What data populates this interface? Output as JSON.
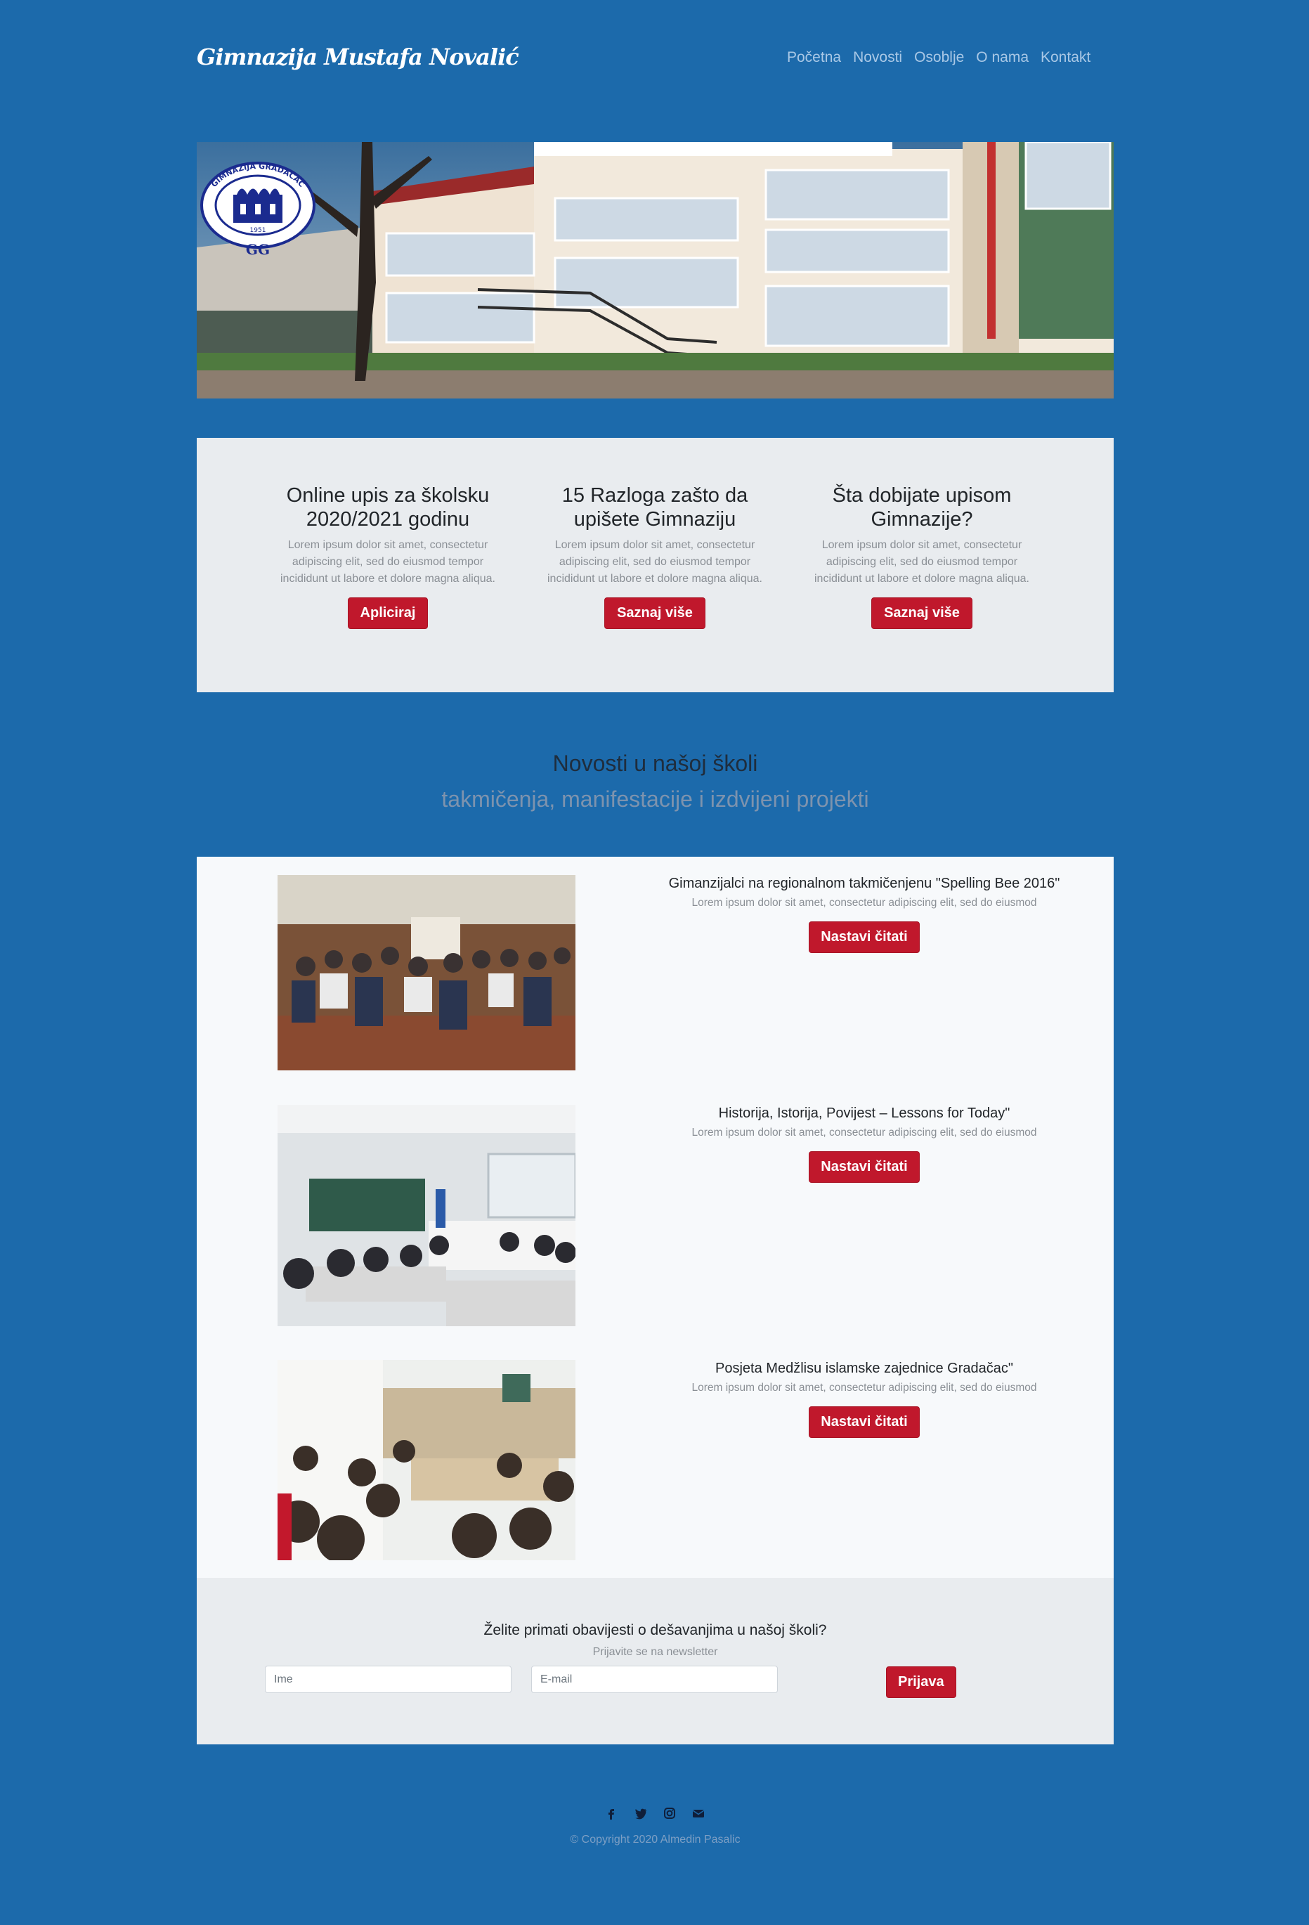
{
  "brand": "Gimnazija Mustafa Novalić",
  "nav": {
    "items": [
      "Početna",
      "Novosti",
      "Osoblje",
      "O nama",
      "Kontakt"
    ]
  },
  "hero": {
    "logo_text": "GIMNAZIJA GRADAČAC",
    "logo_year": "1951",
    "logo_initials": "GG"
  },
  "features": [
    {
      "title": "Online upis za školsku 2020/2021 godinu",
      "text": "Lorem ipsum dolor sit amet, consectetur adipiscing elit, sed do eiusmod tempor incididunt ut labore et dolore magna aliqua.",
      "button": "Apliciraj"
    },
    {
      "title": "15 Razloga zašto da upišete Gimnaziju",
      "text": "Lorem ipsum dolor sit amet, consectetur adipiscing elit, sed do eiusmod tempor incididunt ut labore et dolore magna aliqua.",
      "button": "Saznaj više"
    },
    {
      "title": "Šta dobijate upisom Gimnazije?",
      "text": "Lorem ipsum dolor sit amet, consectetur adipiscing elit, sed do eiusmod tempor incididunt ut labore et dolore magna aliqua.",
      "button": "Saznaj više"
    }
  ],
  "news_section": {
    "title": "Novosti u našoj školi",
    "subtitle": "takmičenja, manifestacije i izdvijeni projekti"
  },
  "news": [
    {
      "title": "Gimanzijalci na regionalnom takmičenjenu \"Spelling Bee 2016\"",
      "text": "Lorem ipsum dolor sit amet, consectetur adipiscing elit, sed do eiusmod",
      "button": "Nastavi čitati"
    },
    {
      "title": "Historija, Istorija, Povijest – Lessons for Today\"",
      "text": "Lorem ipsum dolor sit amet, consectetur adipiscing elit, sed do eiusmod",
      "button": "Nastavi čitati"
    },
    {
      "title": "Posjeta Medžlisu islamske zajednice Gradačac\"",
      "text": "Lorem ipsum dolor sit amet, consectetur adipiscing elit, sed do eiusmod",
      "button": "Nastavi čitati"
    }
  ],
  "newsletter": {
    "title": "Želite primati obavijesti o dešavanjima u našoj školi?",
    "subtitle": "Prijavite se na newsletter",
    "name_placeholder": "Ime",
    "email_placeholder": "E-mail",
    "button": "Prijava"
  },
  "footer": {
    "social_icons": [
      "facebook-icon",
      "twitter-icon",
      "instagram-icon",
      "envelope-icon"
    ],
    "copyright": "© Copyright 2020 Almedin Pasalic"
  },
  "colors": {
    "background": "#1c6aab",
    "accent": "#c0182c",
    "panel": "#e9ecef"
  }
}
